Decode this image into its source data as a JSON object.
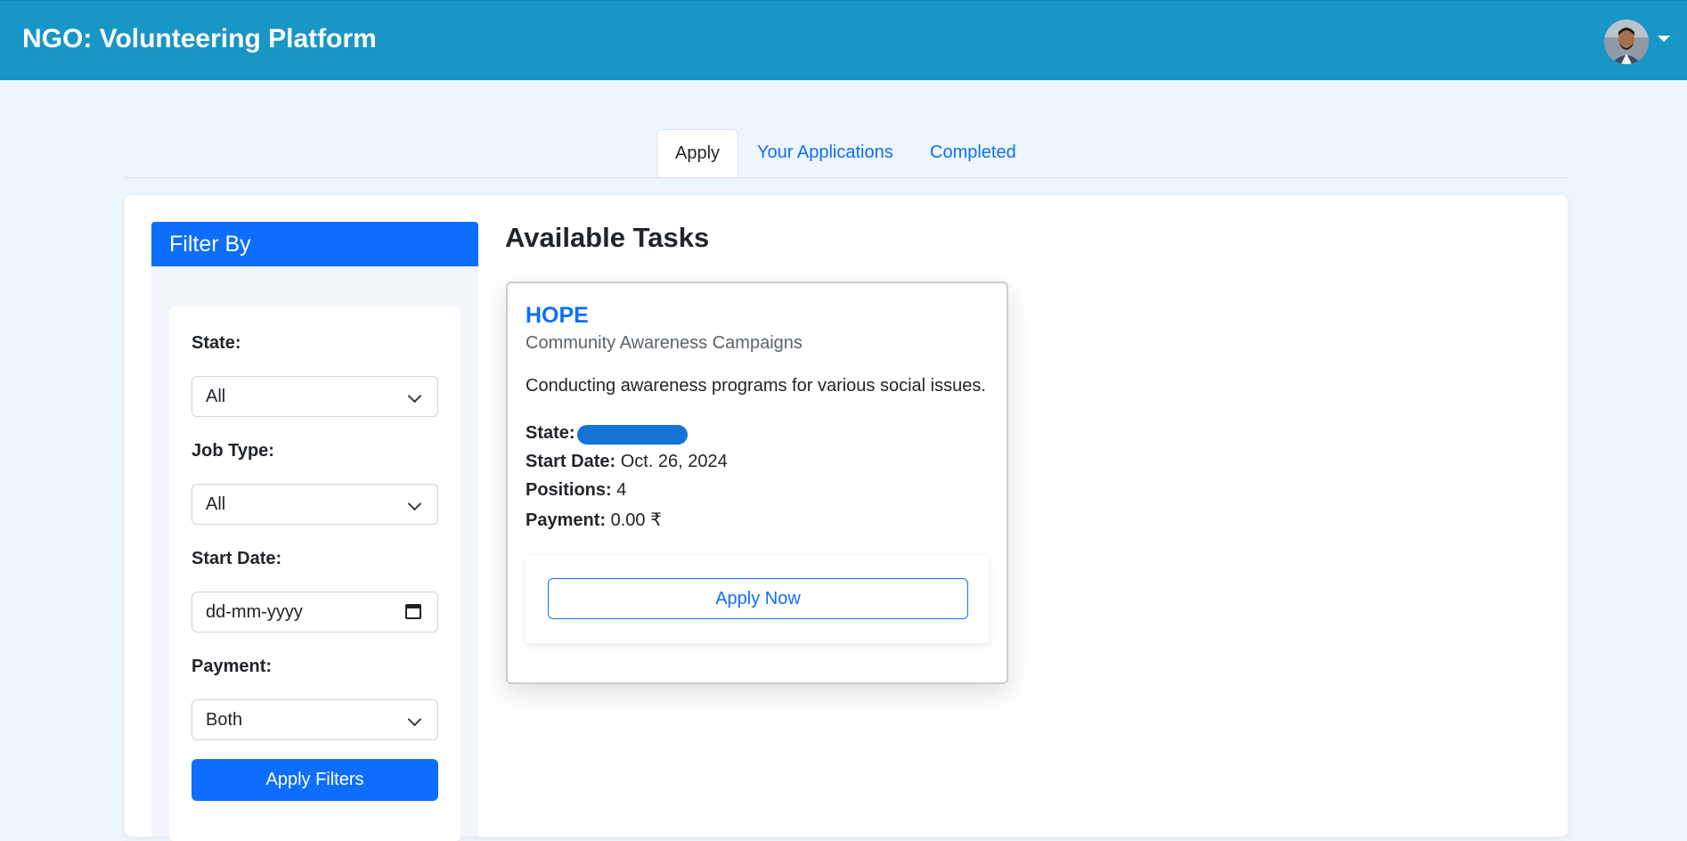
{
  "navbar": {
    "brand": "NGO: Volunteering Platform"
  },
  "tabs": [
    {
      "label": "Apply",
      "active": true
    },
    {
      "label": "Your Applications",
      "active": false
    },
    {
      "label": "Completed",
      "active": false
    }
  ],
  "filter": {
    "header": "Filter By",
    "state_label": "State:",
    "state_value": "All",
    "job_type_label": "Job Type:",
    "job_type_value": "All",
    "start_date_label": "Start Date:",
    "start_date_placeholder": "dd-mm-yyyy",
    "payment_label": "Payment:",
    "payment_value": "Both",
    "apply_button": "Apply Filters"
  },
  "tasks": {
    "title": "Available Tasks",
    "items": [
      {
        "org": "HOPE",
        "category": "Community Awareness Campaigns",
        "description": "Conducting awareness programs for various social issues.",
        "state_label": "State:",
        "start_date_label": "Start Date:",
        "start_date": "Oct. 26, 2024",
        "positions_label": "Positions:",
        "positions": "4",
        "payment_label": "Payment:",
        "payment": "0.00 ₹",
        "apply_button": "Apply Now"
      }
    ]
  },
  "colors": {
    "navbar": "#1896c6",
    "primary": "#0d6efd",
    "page_bg": "#eef6fd"
  }
}
